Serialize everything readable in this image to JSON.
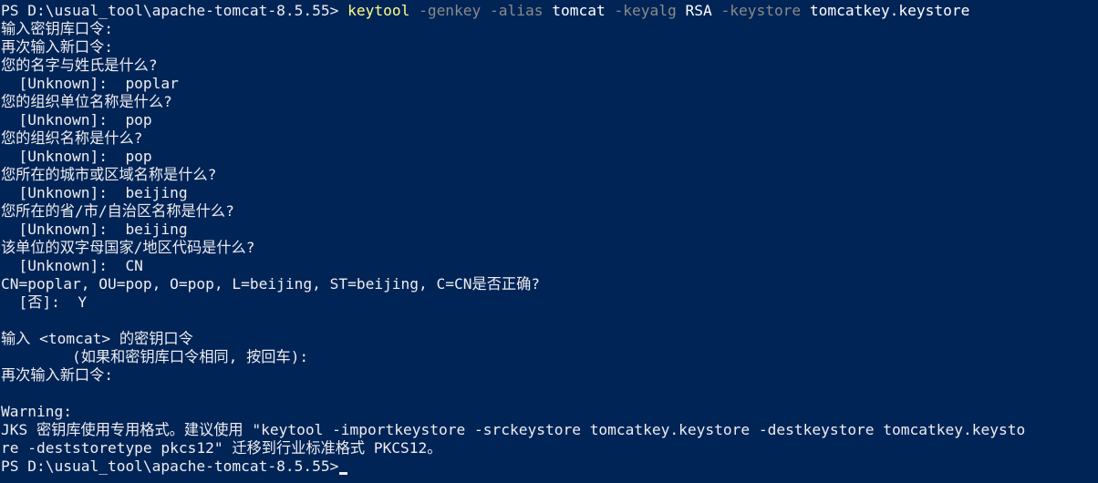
{
  "terminal": {
    "prompt": "PS D:\\usual_tool\\apache-tomcat-8.5.55> ",
    "command": {
      "name": "keytool",
      "p1": " -genkey",
      "p2": " -alias",
      "a2": " tomcat",
      "p3": " -keyalg",
      "a3": " RSA",
      "p4": " -keystore",
      "a4": " tomcatkey.keystore"
    },
    "lines": [
      "输入密钥库口令:",
      "再次输入新口令:",
      "您的名字与姓氏是什么?",
      "  [Unknown]:  poplar",
      "您的组织单位名称是什么?",
      "  [Unknown]:  pop",
      "您的组织名称是什么?",
      "  [Unknown]:  pop",
      "您所在的城市或区域名称是什么?",
      "  [Unknown]:  beijing",
      "您所在的省/市/自治区名称是什么?",
      "  [Unknown]:  beijing",
      "该单位的双字母国家/地区代码是什么?",
      "  [Unknown]:  CN",
      "CN=poplar, OU=pop, O=pop, L=beijing, ST=beijing, C=CN是否正确?",
      "  [否]:  Y",
      "",
      "输入 <tomcat> 的密钥口令",
      "        (如果和密钥库口令相同, 按回车):",
      "再次输入新口令:",
      "",
      "Warning:",
      "JKS 密钥库使用专用格式。建议使用 \"keytool -importkeystore -srckeystore tomcatkey.keystore -destkeystore tomcatkey.keysto",
      "re -deststoretype pkcs12\" 迁移到行业标准格式 PKCS12。"
    ],
    "final_prompt": "PS D:\\usual_tool\\apache-tomcat-8.5.55>"
  }
}
